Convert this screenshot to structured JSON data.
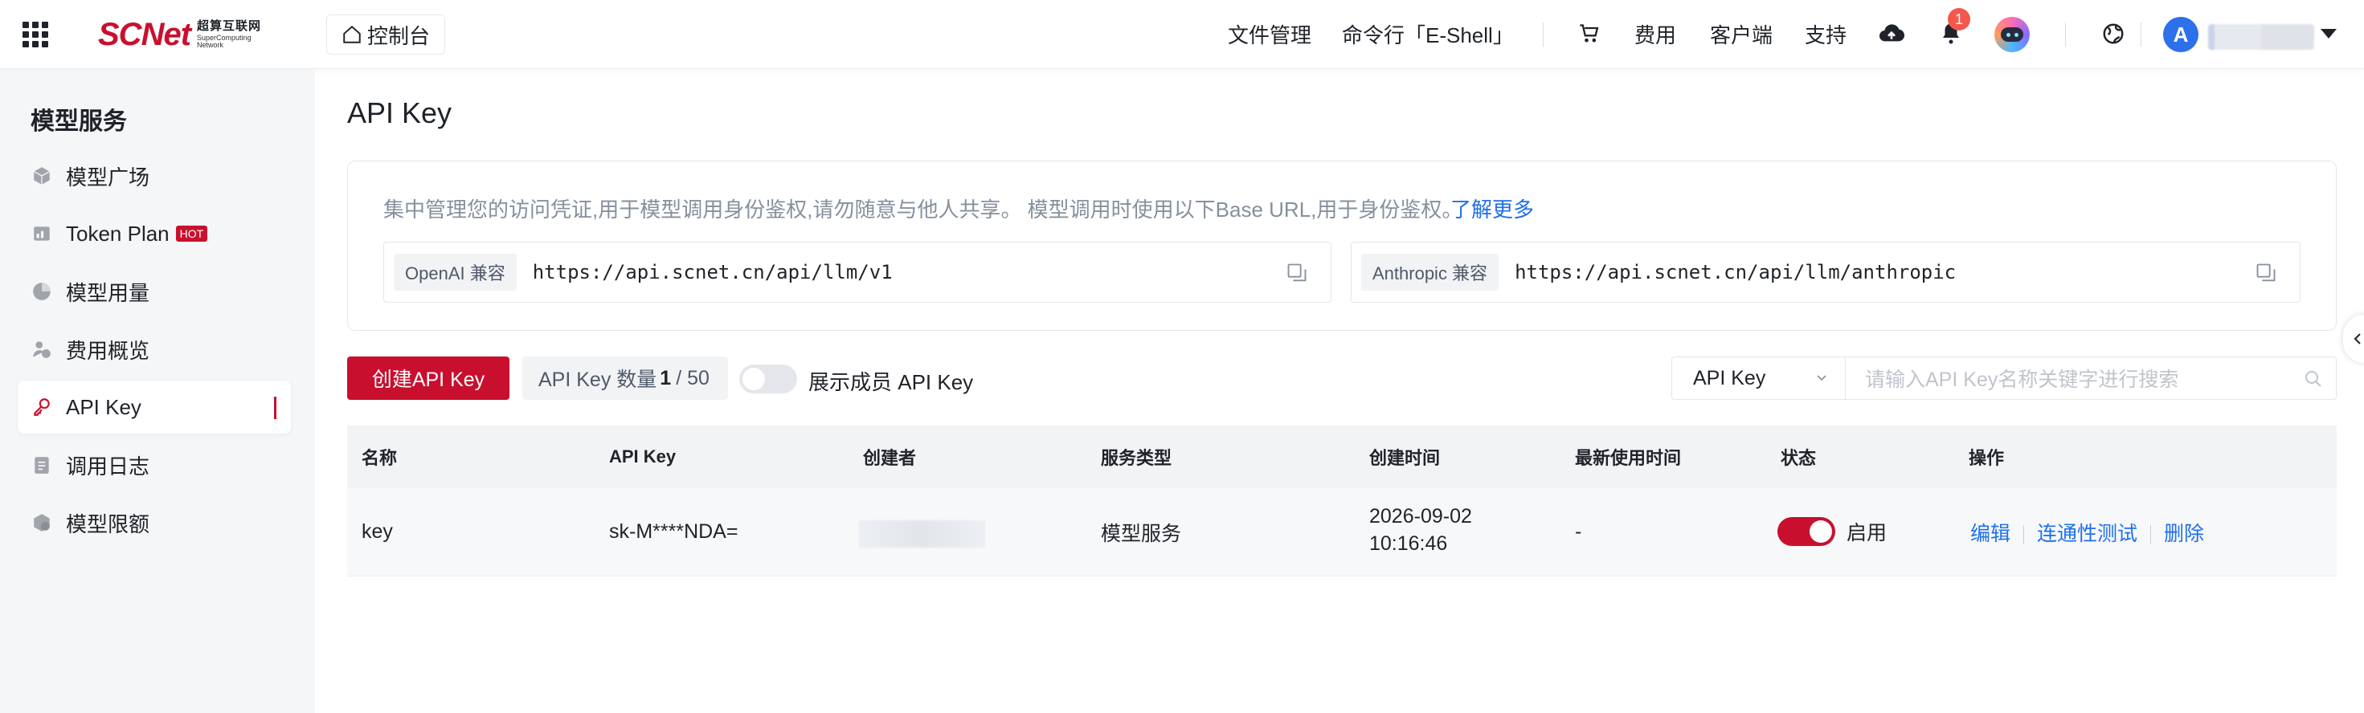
{
  "header": {
    "logo_text": "SCNet",
    "logo_cn": "超算互联网",
    "logo_en_1": "SuperComputing",
    "logo_en_2": "Network",
    "console_label": "控制台",
    "nav": {
      "file_mgmt": "文件管理",
      "eshell": "命令行「E-Shell」",
      "fees": "费用",
      "client": "客户端",
      "support": "支持"
    },
    "notification_count": "1",
    "user_initial": "A"
  },
  "sidebar": {
    "title": "模型服务",
    "items": [
      {
        "label": "模型广场",
        "icon": "cube-icon"
      },
      {
        "label": "Token Plan",
        "icon": "token-icon",
        "badge": "HOT"
      },
      {
        "label": "模型用量",
        "icon": "pie-chart-icon"
      },
      {
        "label": "费用概览",
        "icon": "cost-icon"
      },
      {
        "label": "API Key",
        "icon": "key-icon",
        "active": true
      },
      {
        "label": "调用日志",
        "icon": "log-icon"
      },
      {
        "label": "模型限额",
        "icon": "quota-icon"
      }
    ]
  },
  "main": {
    "title": "API Key",
    "info": {
      "description": "集中管理您的访问凭证,用于模型调用身份鉴权,请勿随意与他人共享。  模型调用时使用以下Base URL,用于身份鉴权。",
      "learn_more": "了解更多",
      "openai_tag": "OpenAI 兼容",
      "openai_url": "https://api.scnet.cn/api/llm/v1",
      "anthropic_tag": "Anthropic 兼容",
      "anthropic_url": "https://api.scnet.cn/api/llm/anthropic"
    },
    "toolbar": {
      "create_label": "创建API Key",
      "count_label": "API Key 数量",
      "count_used": "1",
      "count_total": "/ 50",
      "show_members_label": "展示成员 API Key",
      "search_type": "API Key",
      "search_placeholder": "请输入API Key名称关键字进行搜索"
    },
    "table": {
      "columns": [
        "名称",
        "API Key",
        "创建者",
        "服务类型",
        "创建时间",
        "最新使用时间",
        "状态",
        "操作"
      ],
      "rows": [
        {
          "name": "key",
          "api_key": "sk-M****NDA=",
          "service_type": "模型服务",
          "created_date": "2026-09-02",
          "created_time": "10:16:46",
          "last_used": "-",
          "status": "启用",
          "status_on": true,
          "actions": [
            "编辑",
            "连通性测试",
            "删除"
          ]
        }
      ]
    }
  },
  "colors": {
    "brand": "#c8102e",
    "link": "#1f6feb"
  }
}
